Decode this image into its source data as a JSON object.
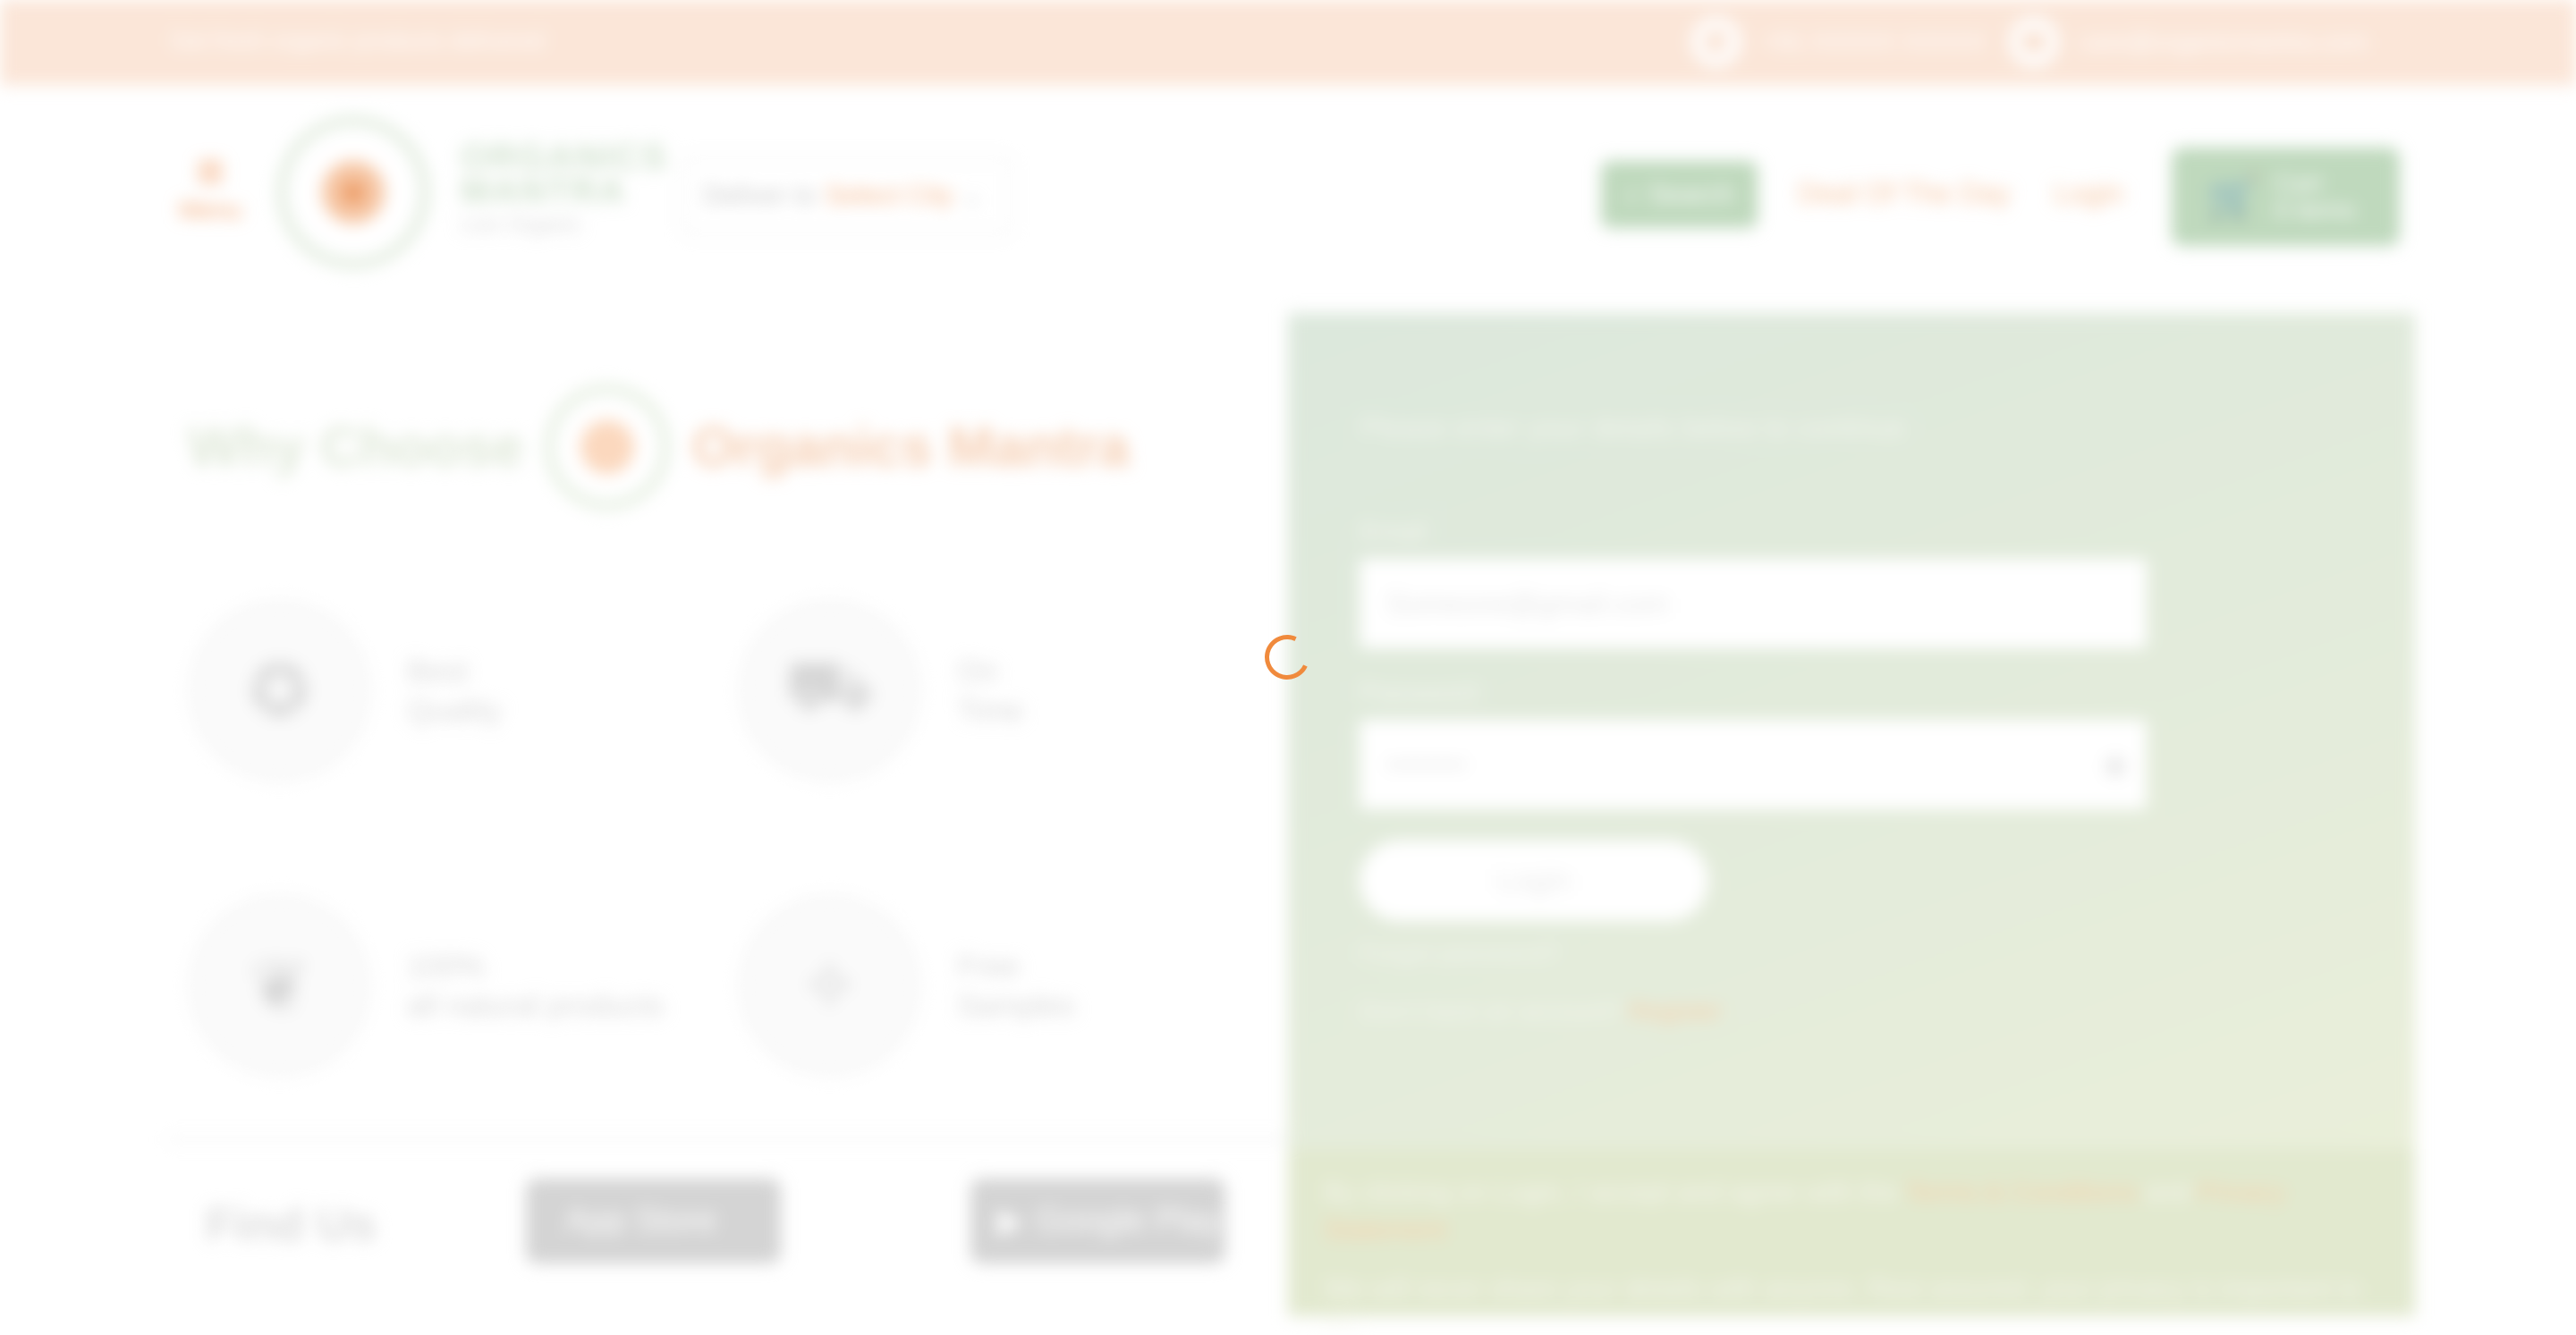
{
  "topbar": {
    "tagline": "Get fresh organic products delivered",
    "phone": "+91 XXXXX XXXXX",
    "email": "care@organicmantra.com"
  },
  "header": {
    "menu_label": "Menu",
    "brand_line1": "ORGANICS",
    "brand_line2": "MANTRA",
    "brand_tagline": "Live Organic",
    "deliver_label": "Deliver to",
    "deliver_location": "Select City",
    "search_label": "Search",
    "deals_label": "Deal Of The Day",
    "login_label": "Login",
    "cart_label": "Cart",
    "cart_count": "0 items"
  },
  "why": {
    "title_part1": "Why Choose",
    "title_part2": "Organics Mantra"
  },
  "features": [
    {
      "line1": "Best",
      "line2": "Quality",
      "icon": "quality-badge-icon"
    },
    {
      "line1": "On",
      "line2": "Time",
      "icon": "delivery-truck-icon"
    },
    {
      "line1": "100%",
      "line2": "all natural products",
      "icon": "natural-basket-icon"
    },
    {
      "line1": "Free",
      "line2": "Samples",
      "icon": "gift-box-icon"
    }
  ],
  "find_us": {
    "title": "Find Us",
    "app_store": "App Store",
    "google_play": "Google Play"
  },
  "login": {
    "intro": "Please enter your details below to continue",
    "email_label": "Email",
    "email_placeholder": "Someone@gmail.com",
    "password_label": "Password",
    "password_placeholder": "••••••••",
    "submit": "Login",
    "forgot": "Forgot password?",
    "signup_prompt": "Don't have an account?",
    "signup_link": "Register",
    "legal_text": "By clicking on Login, I accept and agree with the",
    "terms_link": "Terms & Conditions",
    "and": "and",
    "privacy_link": "Privacy Statement",
    "notice": "We will never share your details with anyone. Rest assured, your privacy is important to us."
  },
  "colors": {
    "accent": "#f08a3c",
    "green": "#bfd9bd",
    "topbar": "#fbe6d8"
  }
}
